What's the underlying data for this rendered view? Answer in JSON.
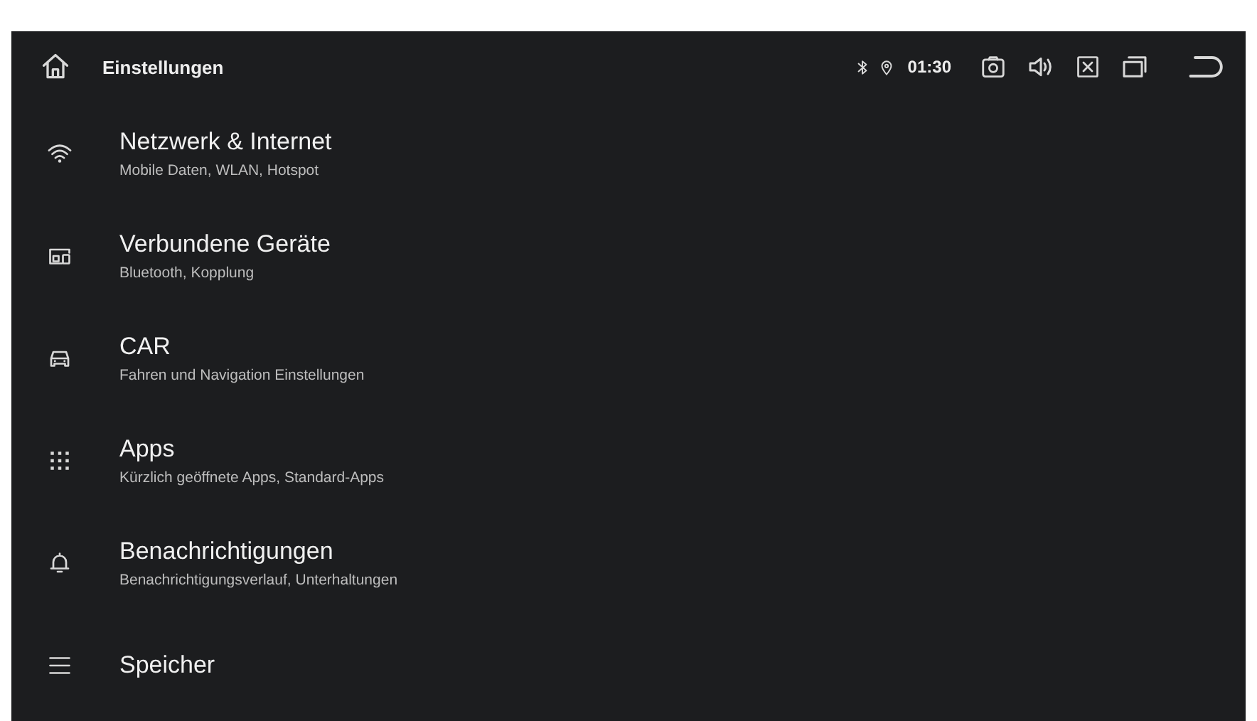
{
  "top_bar": {
    "title": "Einstellungen",
    "time": "01:30"
  },
  "settings": [
    {
      "kind": "wifi",
      "title": "Netzwerk & Internet",
      "subtitle": "Mobile Daten, WLAN, Hotspot"
    },
    {
      "kind": "devices",
      "title": "Verbundene Geräte",
      "subtitle": "Bluetooth, Kopplung"
    },
    {
      "kind": "car",
      "title": "CAR",
      "subtitle": "Fahren und Navigation Einstellungen"
    },
    {
      "kind": "apps",
      "title": "Apps",
      "subtitle": "Kürzlich geöffnete Apps, Standard-Apps"
    },
    {
      "kind": "bell",
      "title": "Benachrichtigungen",
      "subtitle": "Benachrichtigungsverlauf, Unterhaltungen"
    },
    {
      "kind": "storage",
      "title": "Speicher"
    }
  ]
}
